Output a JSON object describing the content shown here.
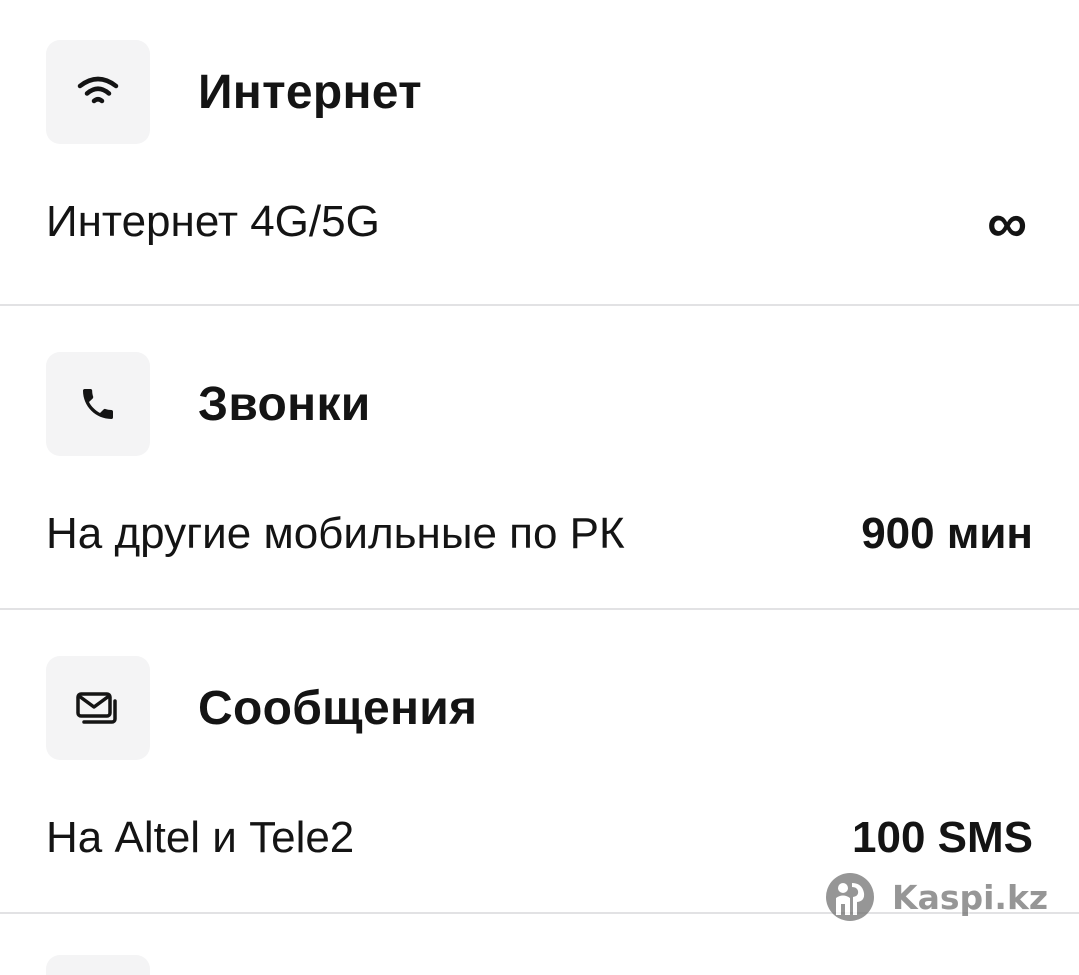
{
  "sections": [
    {
      "title": "Интернет",
      "icon": "wifi-icon",
      "row": {
        "label": "Интернет 4G/5G",
        "value": "∞"
      }
    },
    {
      "title": "Звонки",
      "icon": "phone-icon",
      "row": {
        "label": "На другие мобильные по РК",
        "value": "900 мин"
      }
    },
    {
      "title": "Сообщения",
      "icon": "messages-icon",
      "row": {
        "label": "На Altel и Tele2",
        "value": "100 SMS"
      }
    }
  ],
  "watermark": {
    "text": "Kaspi.kz",
    "icon": "kaspi-logo-icon"
  },
  "colors": {
    "text": "#141414",
    "icon_box_bg": "#f4f4f5",
    "divider": "#e2e2e4",
    "watermark": "#6e6e6e"
  }
}
